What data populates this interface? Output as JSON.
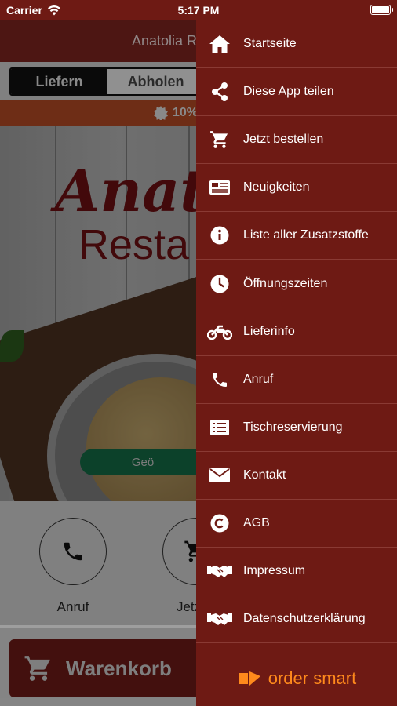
{
  "status_bar": {
    "carrier": "Carrier",
    "time": "5:17 PM"
  },
  "header": {
    "title": "Anatolia R"
  },
  "mode_toggle": {
    "deliver": "Liefern",
    "pickup": "Abholen"
  },
  "promo": {
    "text": "10%"
  },
  "hero": {
    "brand_line1": "Anat",
    "brand_line2": "Resta",
    "pill": "Geö"
  },
  "quick_actions": [
    {
      "label": "Anruf",
      "icon": "phone-icon"
    },
    {
      "label": "Jetzt b",
      "icon": "cart-icon"
    }
  ],
  "cart": {
    "label": "Warenkorb"
  },
  "drawer": {
    "items": [
      {
        "label": "Startseite",
        "icon": "home-icon"
      },
      {
        "label": "Diese App teilen",
        "icon": "share-icon"
      },
      {
        "label": "Jetzt bestellen",
        "icon": "cart-icon"
      },
      {
        "label": "Neuigkeiten",
        "icon": "news-icon"
      },
      {
        "label": "Liste aller Zusatzstoffe",
        "icon": "info-icon"
      },
      {
        "label": "Öffnungszeiten",
        "icon": "clock-icon"
      },
      {
        "label": "Lieferinfo",
        "icon": "motorbike-icon"
      },
      {
        "label": "Anruf",
        "icon": "phone-icon"
      },
      {
        "label": "Tischreservierung",
        "icon": "list-icon"
      },
      {
        "label": "Kontakt",
        "icon": "mail-icon"
      },
      {
        "label": "AGB",
        "icon": "copyright-icon"
      },
      {
        "label": "Impressum",
        "icon": "handshake-icon"
      },
      {
        "label": "Datenschutzerklärung",
        "icon": "handshake-icon"
      }
    ],
    "brand": "order smart"
  },
  "colors": {
    "drawer_bg": "#6e1a14",
    "accent_orange": "#ff8a1c",
    "promo": "#b24a24",
    "pill_green": "#146a45"
  }
}
